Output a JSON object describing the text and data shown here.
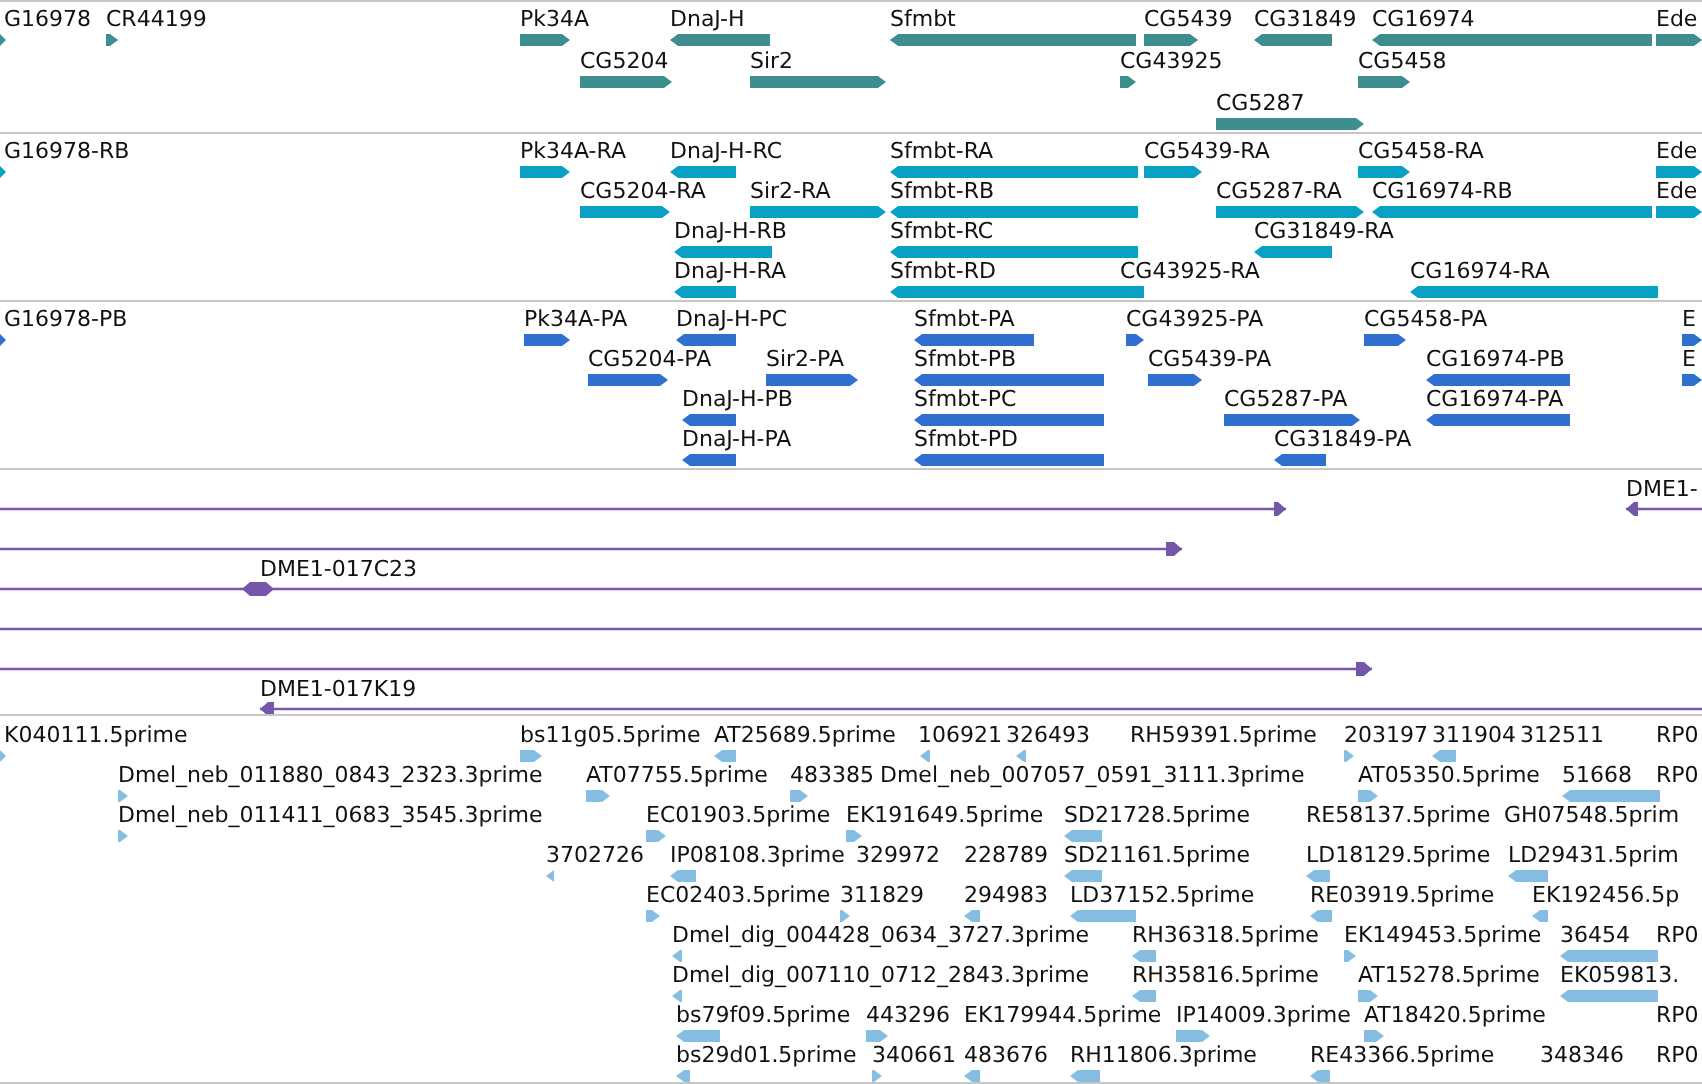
{
  "tracks": [
    {
      "kind": "gene",
      "lanes": [
        {
          "features": [
            {
              "label": "G16978",
              "reverse": false
            },
            {
              "label": "CR44199",
              "reverse": false
            },
            {
              "label": "Pk34A",
              "reverse": false
            },
            {
              "label": "DnaJ-H",
              "reverse": true
            },
            {
              "label": "Sfmbt",
              "reverse": true
            },
            {
              "label": "CG5439",
              "reverse": false
            },
            {
              "label": "CG31849",
              "reverse": true
            },
            {
              "label": "CG16974",
              "reverse": true
            },
            {
              "label": "Ede",
              "reverse": false
            }
          ]
        },
        {
          "features": [
            {
              "label": "CG5204",
              "reverse": false
            },
            {
              "label": "Sir2",
              "reverse": false
            },
            {
              "label": "CG43925",
              "reverse": false
            },
            {
              "label": "CG5458",
              "reverse": false
            }
          ]
        },
        {
          "features": [
            {
              "label": "CG5287",
              "reverse": false
            }
          ]
        }
      ]
    },
    {
      "kind": "transcript",
      "lanes": [
        {
          "features": [
            {
              "label": "G16978-RB",
              "reverse": false
            },
            {
              "label": "Pk34A-RA",
              "reverse": false
            },
            {
              "label": "DnaJ-H-RC",
              "reverse": true
            },
            {
              "label": "Sfmbt-RA",
              "reverse": true
            },
            {
              "label": "CG5439-RA",
              "reverse": false
            },
            {
              "label": "CG5458-RA",
              "reverse": false
            },
            {
              "label": "Ede",
              "reverse": false
            }
          ]
        },
        {
          "features": [
            {
              "label": "CG5204-RA",
              "reverse": false
            },
            {
              "label": "Sir2-RA",
              "reverse": false
            },
            {
              "label": "Sfmbt-RB",
              "reverse": true
            },
            {
              "label": "CG5287-RA",
              "reverse": false
            },
            {
              "label": "CG16974-RB",
              "reverse": true
            },
            {
              "label": "Ede",
              "reverse": false
            }
          ]
        },
        {
          "features": [
            {
              "label": "DnaJ-H-RB",
              "reverse": true
            },
            {
              "label": "Sfmbt-RC",
              "reverse": true
            },
            {
              "label": "CG31849-RA",
              "reverse": true
            }
          ]
        },
        {
          "features": [
            {
              "label": "DnaJ-H-RA",
              "reverse": true
            },
            {
              "label": "Sfmbt-RD",
              "reverse": true
            },
            {
              "label": "CG43925-RA"
            },
            {
              "label": "CG16974-RA",
              "reverse": true
            }
          ]
        }
      ]
    },
    {
      "kind": "protein",
      "lanes": [
        {
          "features": [
            {
              "label": "G16978-PB",
              "reverse": false
            },
            {
              "label": "Pk34A-PA",
              "reverse": false
            },
            {
              "label": "DnaJ-H-PC",
              "reverse": true
            },
            {
              "label": "Sfmbt-PA",
              "reverse": true
            },
            {
              "label": "CG43925-PA",
              "reverse": false
            },
            {
              "label": "CG5458-PA",
              "reverse": false
            },
            {
              "label": "E",
              "reverse": false
            }
          ]
        },
        {
          "features": [
            {
              "label": "CG5204-PA",
              "reverse": false
            },
            {
              "label": "Sir2-PA",
              "reverse": false
            },
            {
              "label": "Sfmbt-PB",
              "reverse": true
            },
            {
              "label": "CG5439-PA",
              "reverse": false
            },
            {
              "label": "CG16974-PB",
              "reverse": true
            },
            {
              "label": "E",
              "reverse": false
            }
          ]
        },
        {
          "features": [
            {
              "label": "DnaJ-H-PB",
              "reverse": true
            },
            {
              "label": "Sfmbt-PC",
              "reverse": true
            },
            {
              "label": "CG5287-PA",
              "reverse": false
            },
            {
              "label": "CG16974-PA",
              "reverse": true
            }
          ]
        },
        {
          "features": [
            {
              "label": "DnaJ-H-PA",
              "reverse": true
            },
            {
              "label": "Sfmbt-PD",
              "reverse": true
            },
            {
              "label": "CG31849-PA",
              "reverse": true
            }
          ]
        }
      ]
    },
    {
      "kind": "clone",
      "clones": [
        {
          "kind": "arrow",
          "reverse": false
        },
        {
          "kind": "arrow",
          "label": "DME1-",
          "reverse": true
        },
        {
          "kind": "arrow",
          "reverse": false
        },
        {
          "kind": "hexagon",
          "label": "DME1-017C23"
        },
        {
          "kind": "line"
        },
        {
          "kind": "arrow",
          "reverse": false
        },
        {
          "kind": "arrow",
          "label": "DME1-017K19",
          "reverse": true
        }
      ]
    },
    {
      "kind": "est",
      "lanes": [
        {
          "features": [
            {
              "label": "K040111.5prime",
              "reverse": false
            },
            {
              "label": "bs11g05.5prime",
              "reverse": false
            },
            {
              "label": "AT25689.5prime",
              "reverse": true
            },
            {
              "label": "106921",
              "reverse": true
            },
            {
              "label": "326493",
              "reverse": true
            },
            {
              "label": "RH59391.5prime"
            },
            {
              "label": "203197",
              "reverse": false
            },
            {
              "label": "311904",
              "reverse": true
            },
            {
              "label": "312511"
            },
            {
              "label": "RP0"
            }
          ]
        },
        {
          "features": [
            {
              "label": "Dmel_neb_011880_0843_2323.3prime",
              "reverse": false
            },
            {
              "label": "AT07755.5prime",
              "reverse": false
            },
            {
              "label": "483385",
              "reverse": false
            },
            {
              "label": "Dmel_neb_007057_0591_3111.3prime"
            },
            {
              "label": "AT05350.5prime",
              "reverse": false
            },
            {
              "label": "51668",
              "reverse": true
            },
            {
              "label": "RP0"
            }
          ]
        },
        {
          "features": [
            {
              "label": "Dmel_neb_011411_0683_3545.3prime",
              "reverse": false
            },
            {
              "label": "EC01903.5prime",
              "reverse": false
            },
            {
              "label": "EK191649.5prime",
              "reverse": false
            },
            {
              "label": "SD21728.5prime",
              "reverse": true
            },
            {
              "label": "RE58137.5prime"
            },
            {
              "label": "GH07548.5prim"
            }
          ]
        },
        {
          "features": [
            {
              "label": "3702726",
              "reverse": true
            },
            {
              "label": "IP08108.3prime",
              "reverse": true
            },
            {
              "label": "329972"
            },
            {
              "label": "228789"
            },
            {
              "label": "SD21161.5prime",
              "reverse": true
            },
            {
              "label": "LD18129.5prime",
              "reverse": true
            },
            {
              "label": "LD29431.5prim",
              "reverse": true
            }
          ]
        },
        {
          "features": [
            {
              "label": "EC02403.5prime",
              "reverse": false
            },
            {
              "label": "311829",
              "reverse": false
            },
            {
              "label": "294983",
              "reverse": true
            },
            {
              "label": "LD37152.5prime",
              "reverse": true
            },
            {
              "label": "RE03919.5prime",
              "reverse": true
            },
            {
              "label": "EK192456.5p",
              "reverse": true
            }
          ]
        },
        {
          "features": [
            {
              "label": "Dmel_dig_004428_0634_3727.3prime",
              "reverse": true
            },
            {
              "label": "RH36318.5prime",
              "reverse": true
            },
            {
              "label": "EK149453.5prime",
              "reverse": false
            },
            {
              "label": "36454",
              "reverse": true
            },
            {
              "label": "RP0"
            }
          ]
        },
        {
          "features": [
            {
              "label": "Dmel_dig_007110_0712_2843.3prime",
              "reverse": true
            },
            {
              "label": "RH35816.5prime",
              "reverse": true
            },
            {
              "label": "AT15278.5prime",
              "reverse": false
            },
            {
              "label": "EK059813.",
              "reverse": true
            }
          ]
        },
        {
          "features": [
            {
              "label": "bs79f09.5prime",
              "reverse": true
            },
            {
              "label": "443296",
              "reverse": false
            },
            {
              "label": "EK179944.5prime"
            },
            {
              "label": "IP14009.3prime",
              "reverse": false
            },
            {
              "label": "AT18420.5prime",
              "reverse": false
            },
            {
              "label": "RP0"
            }
          ]
        },
        {
          "features": [
            {
              "label": "bs29d01.5prime",
              "reverse": true
            },
            {
              "label": "340661",
              "reverse": false
            },
            {
              "label": "483676",
              "reverse": true
            },
            {
              "label": "RH11806.3prime",
              "reverse": true
            },
            {
              "label": "RE43366.5prime",
              "reverse": true
            },
            {
              "label": "348346"
            },
            {
              "label": "RP0"
            }
          ]
        }
      ]
    }
  ]
}
